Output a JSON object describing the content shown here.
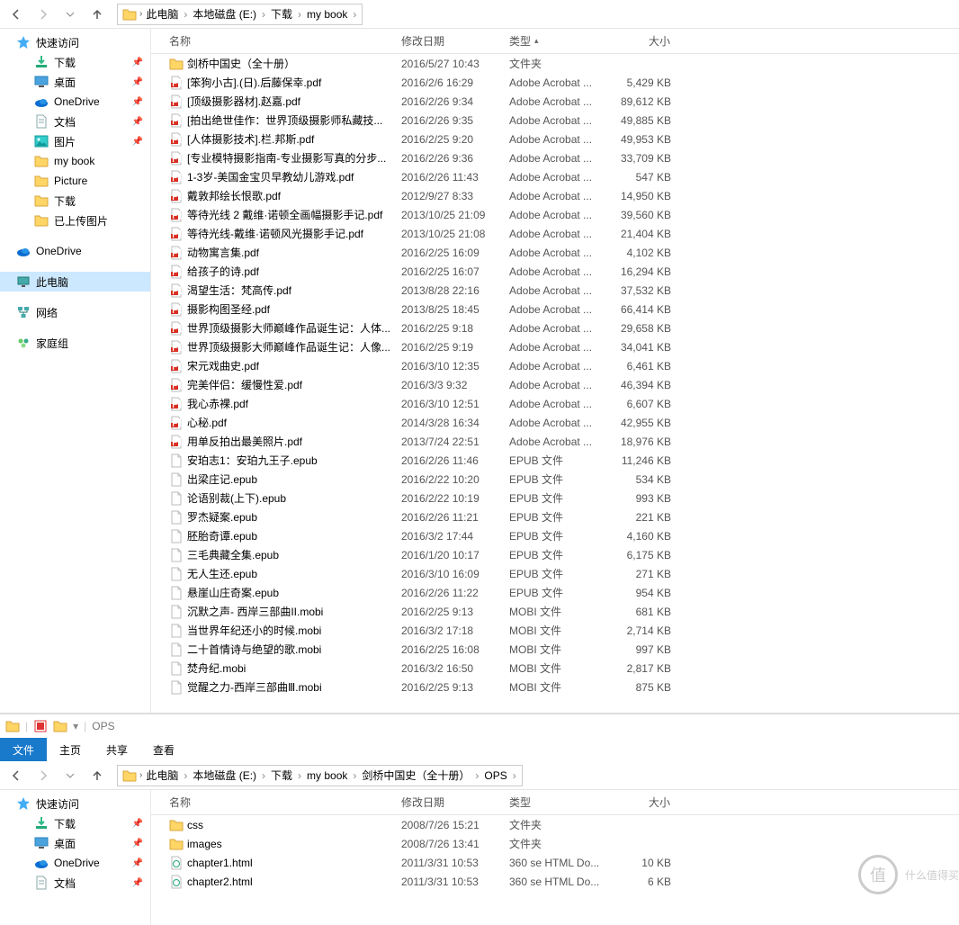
{
  "win1": {
    "breadcrumbs": [
      "此电脑",
      "本地磁盘 (E:)",
      "下载",
      "my book"
    ],
    "sidebar": {
      "quick_label": "快速访问",
      "quick": [
        {
          "label": "下载",
          "icon": "download",
          "pinned": true
        },
        {
          "label": "桌面",
          "icon": "desktop",
          "pinned": true
        },
        {
          "label": "OneDrive",
          "icon": "onedrive",
          "pinned": true
        },
        {
          "label": "文档",
          "icon": "documents",
          "pinned": true
        },
        {
          "label": "图片",
          "icon": "pictures",
          "pinned": true
        },
        {
          "label": "my book",
          "icon": "folder",
          "pinned": false
        },
        {
          "label": "Picture",
          "icon": "folder",
          "pinned": false
        },
        {
          "label": "下载",
          "icon": "folder",
          "pinned": false
        },
        {
          "label": "已上传图片",
          "icon": "folder",
          "pinned": false
        }
      ],
      "groups": [
        {
          "label": "OneDrive",
          "icon": "onedrive"
        },
        {
          "label": "此电脑",
          "icon": "thispc",
          "selected": true
        },
        {
          "label": "网络",
          "icon": "network"
        },
        {
          "label": "家庭组",
          "icon": "homegroup"
        }
      ]
    },
    "columns": {
      "name": "名称",
      "date": "修改日期",
      "type": "类型",
      "size": "大小"
    },
    "sort_col": "type",
    "files": [
      {
        "icon": "folder",
        "name": "剑桥中国史（全十册）",
        "date": "2016/5/27 10:43",
        "type": "文件夹",
        "size": ""
      },
      {
        "icon": "pdf",
        "name": "[笨狗小古].(日).后藤保幸.pdf",
        "date": "2016/2/6 16:29",
        "type": "Adobe Acrobat ...",
        "size": "5,429 KB"
      },
      {
        "icon": "pdf",
        "name": "[顶级摄影器材].赵嘉.pdf",
        "date": "2016/2/26 9:34",
        "type": "Adobe Acrobat ...",
        "size": "89,612 KB"
      },
      {
        "icon": "pdf",
        "name": "[拍出绝世佳作：世界顶级摄影师私藏技...",
        "date": "2016/2/26 9:35",
        "type": "Adobe Acrobat ...",
        "size": "49,885 KB"
      },
      {
        "icon": "pdf",
        "name": "[人体摄影技术].栏.邦斯.pdf",
        "date": "2016/2/25 9:20",
        "type": "Adobe Acrobat ...",
        "size": "49,953 KB"
      },
      {
        "icon": "pdf",
        "name": "[专业模特摄影指南-专业摄影写真的分步...",
        "date": "2016/2/26 9:36",
        "type": "Adobe Acrobat ...",
        "size": "33,709 KB"
      },
      {
        "icon": "pdf",
        "name": "1-3岁-美国金宝贝早教幼儿游戏.pdf",
        "date": "2016/2/26 11:43",
        "type": "Adobe Acrobat ...",
        "size": "547 KB"
      },
      {
        "icon": "pdf",
        "name": "戴敦邦绘长恨歌.pdf",
        "date": "2012/9/27 8:33",
        "type": "Adobe Acrobat ...",
        "size": "14,950 KB"
      },
      {
        "icon": "pdf",
        "name": "等待光线 2 戴维·诺顿全画幅摄影手记.pdf",
        "date": "2013/10/25 21:09",
        "type": "Adobe Acrobat ...",
        "size": "39,560 KB"
      },
      {
        "icon": "pdf",
        "name": "等待光线-戴维·诺顿风光摄影手记.pdf",
        "date": "2013/10/25 21:08",
        "type": "Adobe Acrobat ...",
        "size": "21,404 KB"
      },
      {
        "icon": "pdf",
        "name": "动物寓言集.pdf",
        "date": "2016/2/25 16:09",
        "type": "Adobe Acrobat ...",
        "size": "4,102 KB"
      },
      {
        "icon": "pdf",
        "name": "给孩子的诗.pdf",
        "date": "2016/2/25 16:07",
        "type": "Adobe Acrobat ...",
        "size": "16,294 KB"
      },
      {
        "icon": "pdf",
        "name": "渴望生活：梵高传.pdf",
        "date": "2013/8/28 22:16",
        "type": "Adobe Acrobat ...",
        "size": "37,532 KB"
      },
      {
        "icon": "pdf",
        "name": "摄影构图圣经.pdf",
        "date": "2013/8/25 18:45",
        "type": "Adobe Acrobat ...",
        "size": "66,414 KB"
      },
      {
        "icon": "pdf",
        "name": "世界顶级摄影大师巅峰作品诞生记：人体...",
        "date": "2016/2/25 9:18",
        "type": "Adobe Acrobat ...",
        "size": "29,658 KB"
      },
      {
        "icon": "pdf",
        "name": "世界顶级摄影大师巅峰作品诞生记：人像...",
        "date": "2016/2/25 9:19",
        "type": "Adobe Acrobat ...",
        "size": "34,041 KB"
      },
      {
        "icon": "pdf",
        "name": "宋元戏曲史.pdf",
        "date": "2016/3/10 12:35",
        "type": "Adobe Acrobat ...",
        "size": "6,461 KB"
      },
      {
        "icon": "pdf",
        "name": "完美伴侣：缓慢性爱.pdf",
        "date": "2016/3/3 9:32",
        "type": "Adobe Acrobat ...",
        "size": "46,394 KB"
      },
      {
        "icon": "pdf",
        "name": "我心赤裸.pdf",
        "date": "2016/3/10 12:51",
        "type": "Adobe Acrobat ...",
        "size": "6,607 KB"
      },
      {
        "icon": "pdf",
        "name": "心秘.pdf",
        "date": "2014/3/28 16:34",
        "type": "Adobe Acrobat ...",
        "size": "42,955 KB"
      },
      {
        "icon": "pdf",
        "name": "用单反拍出最美照片.pdf",
        "date": "2013/7/24 22:51",
        "type": "Adobe Acrobat ...",
        "size": "18,976 KB"
      },
      {
        "icon": "file",
        "name": "安珀志1：安珀九王子.epub",
        "date": "2016/2/26 11:46",
        "type": "EPUB 文件",
        "size": "11,246 KB"
      },
      {
        "icon": "file",
        "name": "出梁庄记.epub",
        "date": "2016/2/22 10:20",
        "type": "EPUB 文件",
        "size": "534 KB"
      },
      {
        "icon": "file",
        "name": "论语别裁(上下).epub",
        "date": "2016/2/22 10:19",
        "type": "EPUB 文件",
        "size": "993 KB"
      },
      {
        "icon": "file",
        "name": "罗杰疑案.epub",
        "date": "2016/2/26 11:21",
        "type": "EPUB 文件",
        "size": "221 KB"
      },
      {
        "icon": "file",
        "name": "胚胎奇谭.epub",
        "date": "2016/3/2 17:44",
        "type": "EPUB 文件",
        "size": "4,160 KB"
      },
      {
        "icon": "file",
        "name": "三毛典藏全集.epub",
        "date": "2016/1/20 10:17",
        "type": "EPUB 文件",
        "size": "6,175 KB"
      },
      {
        "icon": "file",
        "name": "无人生还.epub",
        "date": "2016/3/10 16:09",
        "type": "EPUB 文件",
        "size": "271 KB"
      },
      {
        "icon": "file",
        "name": "悬崖山庄奇案.epub",
        "date": "2016/2/26 11:22",
        "type": "EPUB 文件",
        "size": "954 KB"
      },
      {
        "icon": "file",
        "name": "沉默之声- 西岸三部曲II.mobi",
        "date": "2016/2/25 9:13",
        "type": "MOBI 文件",
        "size": "681 KB"
      },
      {
        "icon": "file",
        "name": "当世界年纪还小的时候.mobi",
        "date": "2016/3/2 17:18",
        "type": "MOBI 文件",
        "size": "2,714 KB"
      },
      {
        "icon": "file",
        "name": "二十首情诗与绝望的歌.mobi",
        "date": "2016/2/25 16:08",
        "type": "MOBI 文件",
        "size": "997 KB"
      },
      {
        "icon": "file",
        "name": "焚舟纪.mobi",
        "date": "2016/3/2 16:50",
        "type": "MOBI 文件",
        "size": "2,817 KB"
      },
      {
        "icon": "file",
        "name": "觉醒之力-西岸三部曲Ⅲ.mobi",
        "date": "2016/2/25 9:13",
        "type": "MOBI 文件",
        "size": "875 KB"
      }
    ]
  },
  "win2": {
    "title": "OPS",
    "ribbon": [
      "文件",
      "主页",
      "共享",
      "查看"
    ],
    "breadcrumbs": [
      "此电脑",
      "本地磁盘 (E:)",
      "下载",
      "my book",
      "剑桥中国史（全十册）",
      "OPS"
    ],
    "sidebar": {
      "quick_label": "快速访问",
      "quick": [
        {
          "label": "下载",
          "icon": "download",
          "pinned": true
        },
        {
          "label": "桌面",
          "icon": "desktop",
          "pinned": true
        },
        {
          "label": "OneDrive",
          "icon": "onedrive",
          "pinned": true
        },
        {
          "label": "文档",
          "icon": "documents",
          "pinned": true
        }
      ]
    },
    "columns": {
      "name": "名称",
      "date": "修改日期",
      "type": "类型",
      "size": "大小"
    },
    "files": [
      {
        "icon": "folder",
        "name": "css",
        "date": "2008/7/26 15:21",
        "type": "文件夹",
        "size": ""
      },
      {
        "icon": "folder",
        "name": "images",
        "date": "2008/7/26 13:41",
        "type": "文件夹",
        "size": ""
      },
      {
        "icon": "html",
        "name": "chapter1.html",
        "date": "2011/3/31 10:53",
        "type": "360 se HTML Do...",
        "size": "10 KB"
      },
      {
        "icon": "html",
        "name": "chapter2.html",
        "date": "2011/3/31 10:53",
        "type": "360 se HTML Do...",
        "size": "6 KB"
      }
    ]
  },
  "watermark": {
    "text": "什么值得买",
    "badge": "值"
  }
}
